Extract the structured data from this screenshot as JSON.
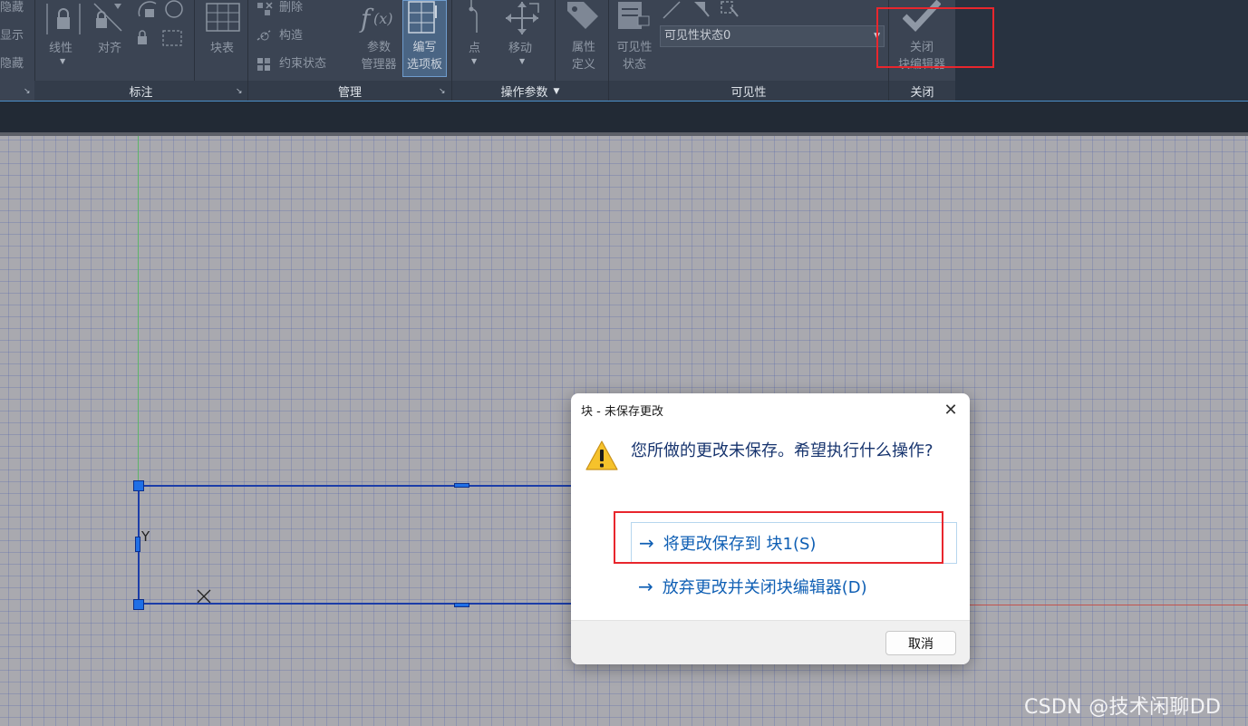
{
  "ribbon": {
    "vis_panel_left_labels": [
      "隐藏",
      "显示",
      "隐藏"
    ],
    "dimension": {
      "linear_label": "线性",
      "align_label": "对齐",
      "block_table_label": "块表",
      "footer": "标注"
    },
    "manage": {
      "delete_label": "删除",
      "construct_label": "构造",
      "constraint_state_label": "约束状态",
      "param_manager_line1": "参数",
      "param_manager_line2": "管理器",
      "authoring_palette_line1": "编写",
      "authoring_palette_line2": "选项板",
      "footer": "管理"
    },
    "action_params": {
      "point_label": "点",
      "move_label": "移动",
      "footer": "操作参数"
    },
    "visibility": {
      "attr_def_line1": "属性",
      "attr_def_line2": "定义",
      "vis_state_line1": "可见性",
      "vis_state_line2": "状态",
      "select_value": "可见性状态0",
      "footer": "可见性"
    },
    "close": {
      "close_editor_line1": "关闭",
      "close_editor_line2": "块编辑器",
      "footer": "关闭"
    }
  },
  "canvas": {
    "ucs_y": "Y",
    "watermark": "CSDN @技术闲聊DD"
  },
  "dialog": {
    "title": "块 - 未保存更改",
    "message": "您所做的更改未保存。希望执行什么操作?",
    "save_command": "将更改保存到 块1(S)",
    "discard_command": "放弃更改并关闭块编辑器(D)",
    "cancel_button": "取消",
    "close_glyph": "✕"
  },
  "colors": {
    "ribbon_bg": "#3b4453",
    "highlight_red": "#e8262d",
    "command_link": "#0f5fb4",
    "grip_blue": "#1f6fe6"
  }
}
